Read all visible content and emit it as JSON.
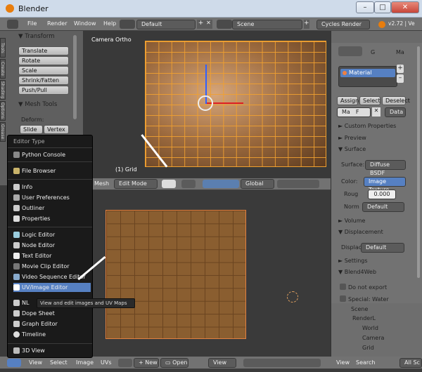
{
  "window": {
    "title": "Blender",
    "controls": [
      "–",
      "□",
      "✕"
    ]
  },
  "topbar": {
    "menus": [
      "File",
      "Render",
      "Window",
      "Help"
    ],
    "layout": "Default",
    "scene": "Scene",
    "engine": "Cycles Render",
    "version": "v2.72 | Ve"
  },
  "tool_shelf": {
    "tabs": [
      "Tools",
      "Create",
      "Shading",
      "Options",
      "Grease Pencil"
    ],
    "transform": {
      "title": "Transform",
      "buttons": [
        "Translate",
        "Rotate",
        "Scale",
        "Shrink/Fatten",
        "Push/Pull"
      ]
    },
    "mesh_tools": {
      "title": "Mesh Tools",
      "deform_label": "Deform:",
      "buttons": [
        "Slide Ed",
        "Vertex"
      ]
    }
  },
  "viewport": {
    "label": "Camera Ortho",
    "object": "(1) Grid"
  },
  "view3d_header": {
    "items": [
      "Mesh"
    ],
    "mode": "Edit Mode",
    "orientation": "Global"
  },
  "editor_menu": {
    "title": "Editor Type",
    "groups": [
      [
        "Python Console"
      ],
      [
        "File Browser"
      ],
      [
        "Info",
        "User Preferences",
        "Outliner",
        "Properties"
      ],
      [
        "Logic Editor",
        "Node Editor",
        "Text Editor",
        "Movie Clip Editor",
        "Video Sequence Editor",
        "UV/Image Editor",
        "NLA Editor",
        "Dope Sheet",
        "Graph Editor",
        "Timeline"
      ],
      [
        "3D View"
      ]
    ],
    "selected": "UV/Image Editor",
    "partial_label": "NL",
    "tooltip": "View and edit images and UV Maps"
  },
  "uv_header": {
    "items": [
      "View",
      "Select",
      "Image",
      "UVs"
    ],
    "new_label": "New",
    "open_label": "Open",
    "view_label": "View"
  },
  "props": {
    "object_short": "G",
    "mat_short": "Ma",
    "material_name": "Material",
    "btns": [
      "Assign",
      "Select",
      "Deselect"
    ],
    "mat_field": "Ma",
    "f_label": "F",
    "data_label": "Data",
    "sections": {
      "custom": "Custom Properties",
      "preview": "Preview",
      "surface": "Surface",
      "volume": "Volume",
      "displacement": "Displacement",
      "settings": "Settings",
      "blend4web": "Blend4Web"
    },
    "surface_label": "Surface:",
    "surface_value": "Diffuse BSDF",
    "color_label": "Color:",
    "color_value": "Image Texture",
    "rough_label": "Roug",
    "rough_value": "0.000",
    "norm_label": "Norm",
    "norm_value": "Default",
    "displac_label": "Displac:",
    "displac_value": "Default",
    "do_not_export": "Do not export",
    "special_water": "Special: Water"
  },
  "outliner": {
    "items": [
      "Scene",
      "RenderL",
      "World",
      "Camera",
      "Grid"
    ]
  },
  "bottom_right": {
    "view": "View",
    "search": "Search",
    "all": "All Sc"
  },
  "colors": {
    "menu_bg": "#1a1a1a",
    "highlight": "#5680c2",
    "grid": "#f0a030"
  }
}
